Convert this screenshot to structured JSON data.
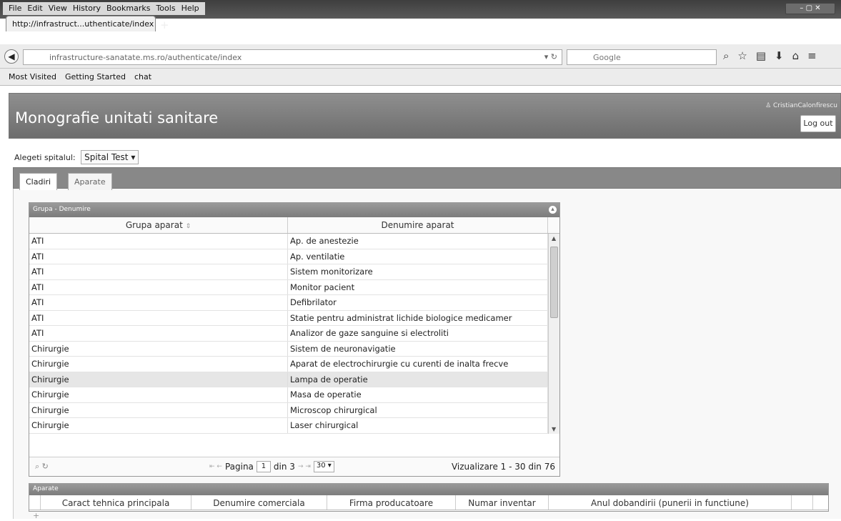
{
  "browser": {
    "menus": [
      "File",
      "Edit",
      "View",
      "History",
      "Bookmarks",
      "Tools",
      "Help"
    ],
    "tab_title": "http://infrastruct...uthenticate/index",
    "url": "infrastructure-sanatate.ms.ro/authenticate/index",
    "search_engine": "Google",
    "bookmarks": [
      "Most Visited",
      "Getting Started",
      "chat"
    ]
  },
  "app": {
    "title": "Monografie unitati sanitare",
    "user": "CristianCalonfirescu",
    "logout_label": "Log out"
  },
  "hospital": {
    "label": "Alegeti spitalul:",
    "selected": "Spital Test"
  },
  "tabs": [
    {
      "label": "Cladiri"
    },
    {
      "label": "Aparate"
    }
  ],
  "grid1": {
    "caption": "Grupa - Denumire",
    "columns": [
      "Grupa aparat",
      "Denumire aparat"
    ],
    "rows": [
      {
        "grupa": "ATI",
        "denumire": "Ap. de anestezie"
      },
      {
        "grupa": "ATI",
        "denumire": "Ap. ventilatie"
      },
      {
        "grupa": "ATI",
        "denumire": "Sistem monitorizare"
      },
      {
        "grupa": "ATI",
        "denumire": "Monitor pacient"
      },
      {
        "grupa": "ATI",
        "denumire": "Defibrilator"
      },
      {
        "grupa": "ATI",
        "denumire": "Statie pentru administrat lichide biologice medicamer"
      },
      {
        "grupa": "ATI",
        "denumire": "Analizor de gaze sanguine si electroliti"
      },
      {
        "grupa": "Chirurgie",
        "denumire": "Sistem de neuronavigatie"
      },
      {
        "grupa": "Chirurgie",
        "denumire": "Aparat  de electrochirurgie cu curenti de inalta frecve"
      },
      {
        "grupa": "Chirurgie",
        "denumire": "Lampa de operatie"
      },
      {
        "grupa": "Chirurgie",
        "denumire": "Masa de operatie"
      },
      {
        "grupa": "Chirurgie",
        "denumire": "Microscop chirurgical"
      },
      {
        "grupa": "Chirurgie",
        "denumire": "Laser chirurgical"
      }
    ],
    "selected_row": 9,
    "pager": {
      "page_label": "Pagina",
      "page": "1",
      "of_label": "din 3",
      "rows_per_page": "30",
      "info": "Vizualizare 1 - 30 din 76"
    }
  },
  "grid2": {
    "caption": "Aparate",
    "columns": [
      "Caract tehnica principala",
      "Denumire comerciala",
      "Firma producatoare",
      "Numar inventar",
      "Anul dobandirii (punerii in functiune)"
    ]
  }
}
